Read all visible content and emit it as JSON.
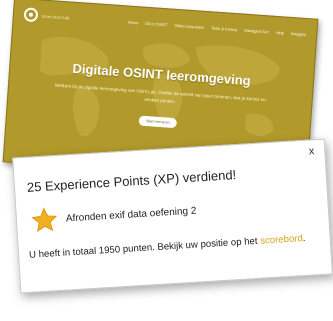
{
  "site": {
    "brand": "osint.tech.lab",
    "menu": [
      "Home",
      "Dit is OSINT",
      "Video cursussen",
      "Tools & Kennis",
      "Managed Svc",
      "Help",
      "Inloggen"
    ],
    "hero_title": "Digitale OSINT leeromgeving",
    "hero_subtitle": "Welkom bij de digitale leeromgeving van Osint Lab. Ontdek de wereld van open bronnen, test je kennis en verdien punten.",
    "cta_label": "Start met leren",
    "colors": {
      "background": "#b19a2b",
      "text": "#ffffff"
    }
  },
  "popup": {
    "close_label": "x",
    "title": "25 Experience Points (XP) verdiend!",
    "award_icon": "star-icon",
    "award_label": "Afronden exif data oefening 2",
    "total_text": "U heeft in totaal 1950 punten. Bekijk uw positie op het ",
    "scoreboard_link": "scorebord",
    "total_end": ".",
    "colors": {
      "star": "#f2b01e",
      "link": "#d4a51c"
    }
  }
}
